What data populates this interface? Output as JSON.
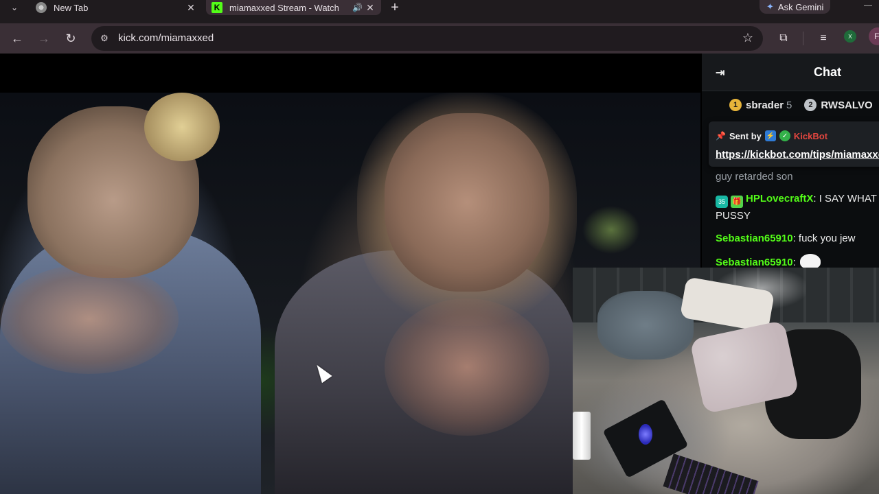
{
  "browser": {
    "tabs": [
      {
        "title": "New Tab",
        "active": false,
        "favicon": "chrome-icon"
      },
      {
        "title": "miamaxxed Stream - Watch",
        "active": true,
        "favicon": "kick-icon",
        "audio": true
      }
    ],
    "kick_favicon_glyph": "K",
    "gemini_label": "Ask Gemini",
    "url": "kick.com/miamaxxed",
    "profile_initial": "x",
    "profile2_initial": "F"
  },
  "chat": {
    "title": "Chat",
    "leaderboard": [
      {
        "rank": "1",
        "name": "sbrader",
        "count": "5"
      },
      {
        "rank": "2",
        "name": "RWSALVO",
        "count": ""
      }
    ],
    "pinned": {
      "sent_by_label": "Sent by",
      "bot_name": "KickBot",
      "link": "https://kickbot.com/tips/miamaxxed"
    },
    "faded_line": "guy retarded son",
    "messages": [
      {
        "badge": "35",
        "user": "HPLovecraftX",
        "text": "I SAY WHAT PUSSY"
      },
      {
        "user": "Sebastian65910",
        "text": "fuck you jew"
      },
      {
        "user": "Sebastian65910",
        "text": ""
      }
    ]
  },
  "colors": {
    "kick_green": "#53fc18",
    "chrome_bg": "#3a2f36",
    "chat_bg": "#0b0d0f"
  }
}
